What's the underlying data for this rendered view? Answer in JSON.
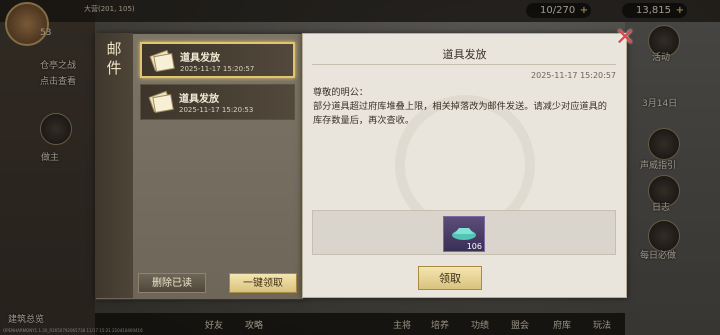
{
  "hud": {
    "level": "53",
    "location": "大营(201, 105)",
    "resource_1": "10/270",
    "resource_2": "13,815"
  },
  "sidebar_right": {
    "labels": [
      "活动",
      "3月14日",
      "声威指引",
      "日志",
      "每日必做"
    ]
  },
  "sidebar_left": {
    "labels": [
      "仓亭之战",
      "点击查看",
      "做主",
      "建筑总览"
    ]
  },
  "bottom_bar": {
    "items": [
      "好友",
      "攻略",
      "主将",
      "培养",
      "功绩",
      "盟会",
      "府库",
      "玩法"
    ]
  },
  "mail": {
    "tab_title": "邮件",
    "items": [
      {
        "title": "道具发放",
        "date": "2025-11-17  15:20:57",
        "selected": true
      },
      {
        "title": "道具发放",
        "date": "2025-11-17  15:20:53",
        "selected": false
      }
    ],
    "delete_read_label": "删除已读",
    "claim_all_label": "一键领取",
    "detail": {
      "title": "道具发放",
      "date": "2025-11-17  15:20:57",
      "body": "尊敬的明公：\n部分道具超过府库堆叠上限，相关掉落改为邮件发送。请减少对应道具的库存数量后，再次查收。",
      "attachment_count": "106",
      "claim_label": "领取"
    }
  },
  "footer_id": "OPENHARMONY1.1.30_R2650792065738 11/17 15:21 210410400416",
  "colors": {
    "gold_button": "#e2c56d",
    "close_x": "#d94a4a",
    "panel_bg": "#e9e5dc"
  }
}
